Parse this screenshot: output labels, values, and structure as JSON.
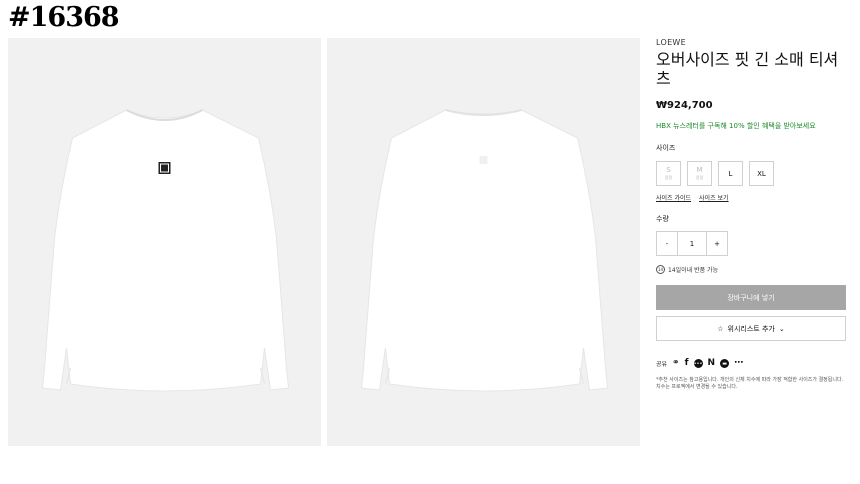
{
  "overlay_tag": "#16368",
  "product": {
    "brand": "LOEWE",
    "title": "오버사이즈 핏 긴 소매 티셔츠",
    "price": "₩924,700",
    "promo": "HBX 뉴스레터를 구독해 10% 할인 혜택을 받아보세요"
  },
  "size": {
    "label": "사이즈",
    "options": [
      {
        "label": "S",
        "sub": "품절",
        "soldout": true
      },
      {
        "label": "M",
        "sub": "품절",
        "soldout": true
      },
      {
        "label": "L",
        "sub": "",
        "soldout": false
      },
      {
        "label": "XL",
        "sub": "",
        "soldout": false
      }
    ],
    "guide_link": "사이즈 가이드",
    "view_link": "사이즈 보기"
  },
  "quantity": {
    "label": "수량",
    "minus": "-",
    "value": "1",
    "plus": "+"
  },
  "returns": {
    "icon": "return-14-icon",
    "icon_text": "14",
    "text": "14일이내 반품 가능"
  },
  "cart_button": "장바구니에 넣기",
  "wishlist_button": "위시리스트 추가",
  "share": {
    "label": "공유",
    "icons": [
      "link-icon",
      "facebook-icon",
      "kakao-icon",
      "naver-icon",
      "line-icon",
      "more-icon"
    ]
  },
  "note": "*추천 사이즈는 참고용입니다. 개인의 신체 치수에 따라 가장 적합한 사이즈가 결정됩니다. 치수는 프로젝에서 변경될 수 있습니다.",
  "colors": {
    "accent_green": "#1a8a2a",
    "cart_button_bg": "#a6a6a6",
    "photo_bg": "#f1f1f1"
  }
}
